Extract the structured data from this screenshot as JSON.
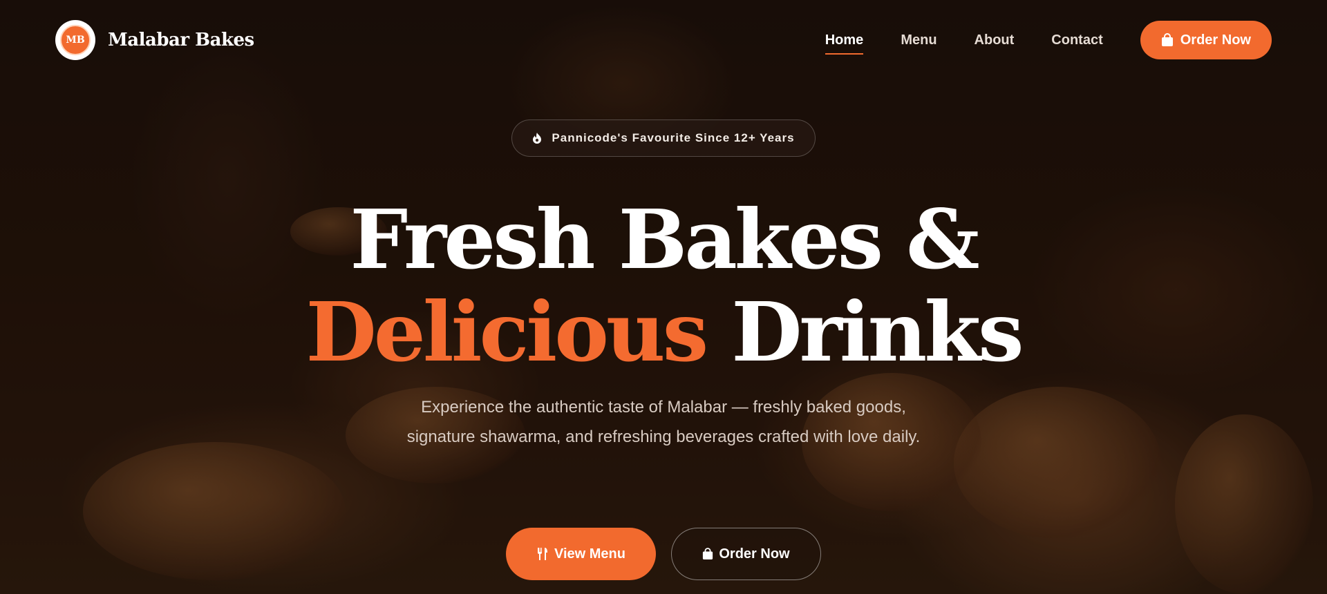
{
  "brand": {
    "logo_text": "MB",
    "name": "Malabar Bakes"
  },
  "nav": {
    "links": [
      "Home",
      "Menu",
      "About",
      "Contact"
    ],
    "active": "Home",
    "order_button": "Order Now"
  },
  "hero": {
    "badge": "Pannicode's Favourite Since 12+ Years",
    "headline_line1": "Fresh Bakes &",
    "headline_accent": "Delicious",
    "headline_line2_rest": " Drinks",
    "subtitle": "Experience the authentic taste of Malabar — freshly baked goods, signature shawarma, and refreshing beverages crafted with love daily.",
    "primary_button": "View Menu",
    "secondary_button": "Order Now"
  },
  "colors": {
    "accent": "#f26a2e",
    "background": "#1a0e08"
  },
  "icons": {
    "badge": "fire-icon",
    "order": "shopping-bag-icon",
    "menu": "utensils-icon"
  }
}
